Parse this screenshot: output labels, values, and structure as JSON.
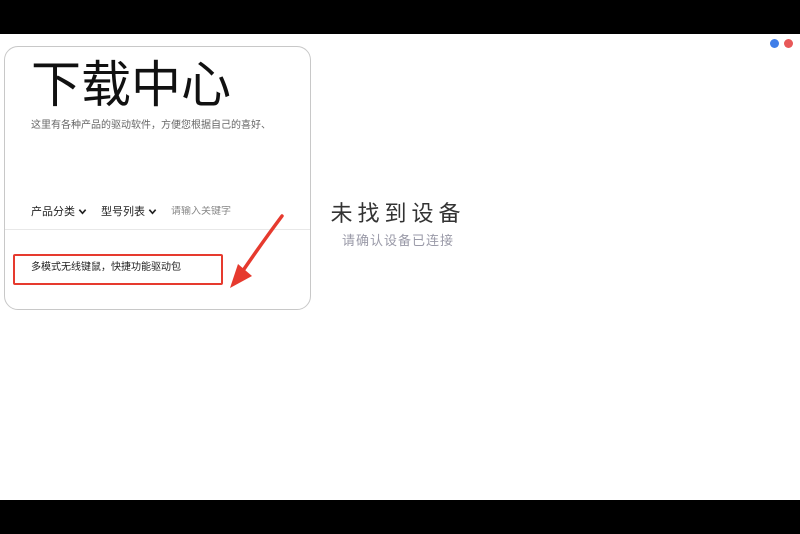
{
  "window": {
    "dots": [
      {
        "name": "blue",
        "color": "#3f7ee8"
      },
      {
        "name": "red",
        "color": "#e85858"
      }
    ]
  },
  "download_center": {
    "title": "下载中心",
    "description": "这里有各种产品的驱动软件，方便您根据自己的喜好、",
    "filters": {
      "category_label": "产品分类",
      "model_label": "型号列表",
      "search_placeholder": "请输入关键字"
    },
    "products": [
      {
        "label": "多模式无线键鼠，快捷功能驱动包"
      }
    ]
  },
  "empty_state": {
    "title": "未找到设备",
    "hint": "请确认设备已连接"
  },
  "annotation": {
    "color": "#e63a2e"
  }
}
